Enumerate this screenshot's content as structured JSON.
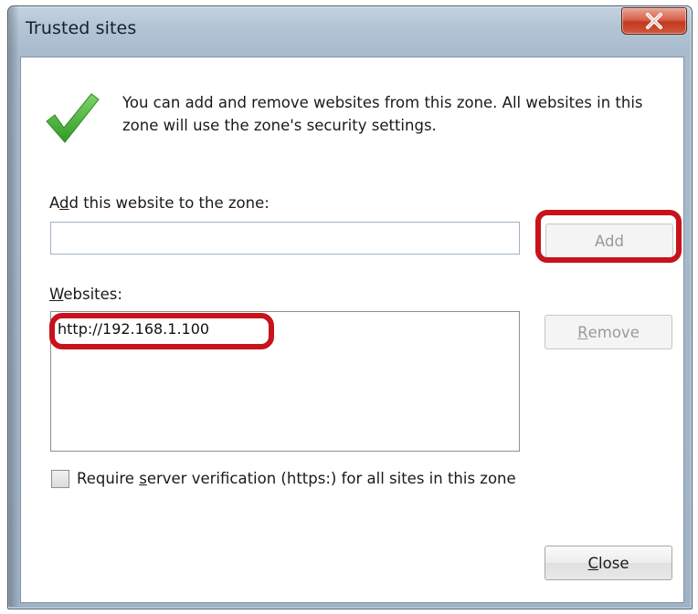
{
  "window": {
    "title": "Trusted sites",
    "close_glyph": "X"
  },
  "intro": {
    "icon": "green-check-icon",
    "text": "You can add and remove websites from this zone. All websites in this zone will use the zone's security settings."
  },
  "add_section": {
    "label_pre": "A",
    "label_access": "d",
    "label_post": "d this website to the zone:",
    "input_value": "",
    "add_button": "Add"
  },
  "websites_section": {
    "label_access": "W",
    "label_post": "ebsites:",
    "items": [
      "http://192.168.1.100"
    ],
    "remove_access": "R",
    "remove_post": "emove"
  },
  "https_option": {
    "checked": false,
    "label_pre": "Require ",
    "label_access": "s",
    "label_post": "erver verification (https:) for all sites in this zone"
  },
  "footer": {
    "close_access": "C",
    "close_post": "lose"
  },
  "colors": {
    "annotation_red": "#c8121c",
    "check_green": "#3aa52b"
  }
}
